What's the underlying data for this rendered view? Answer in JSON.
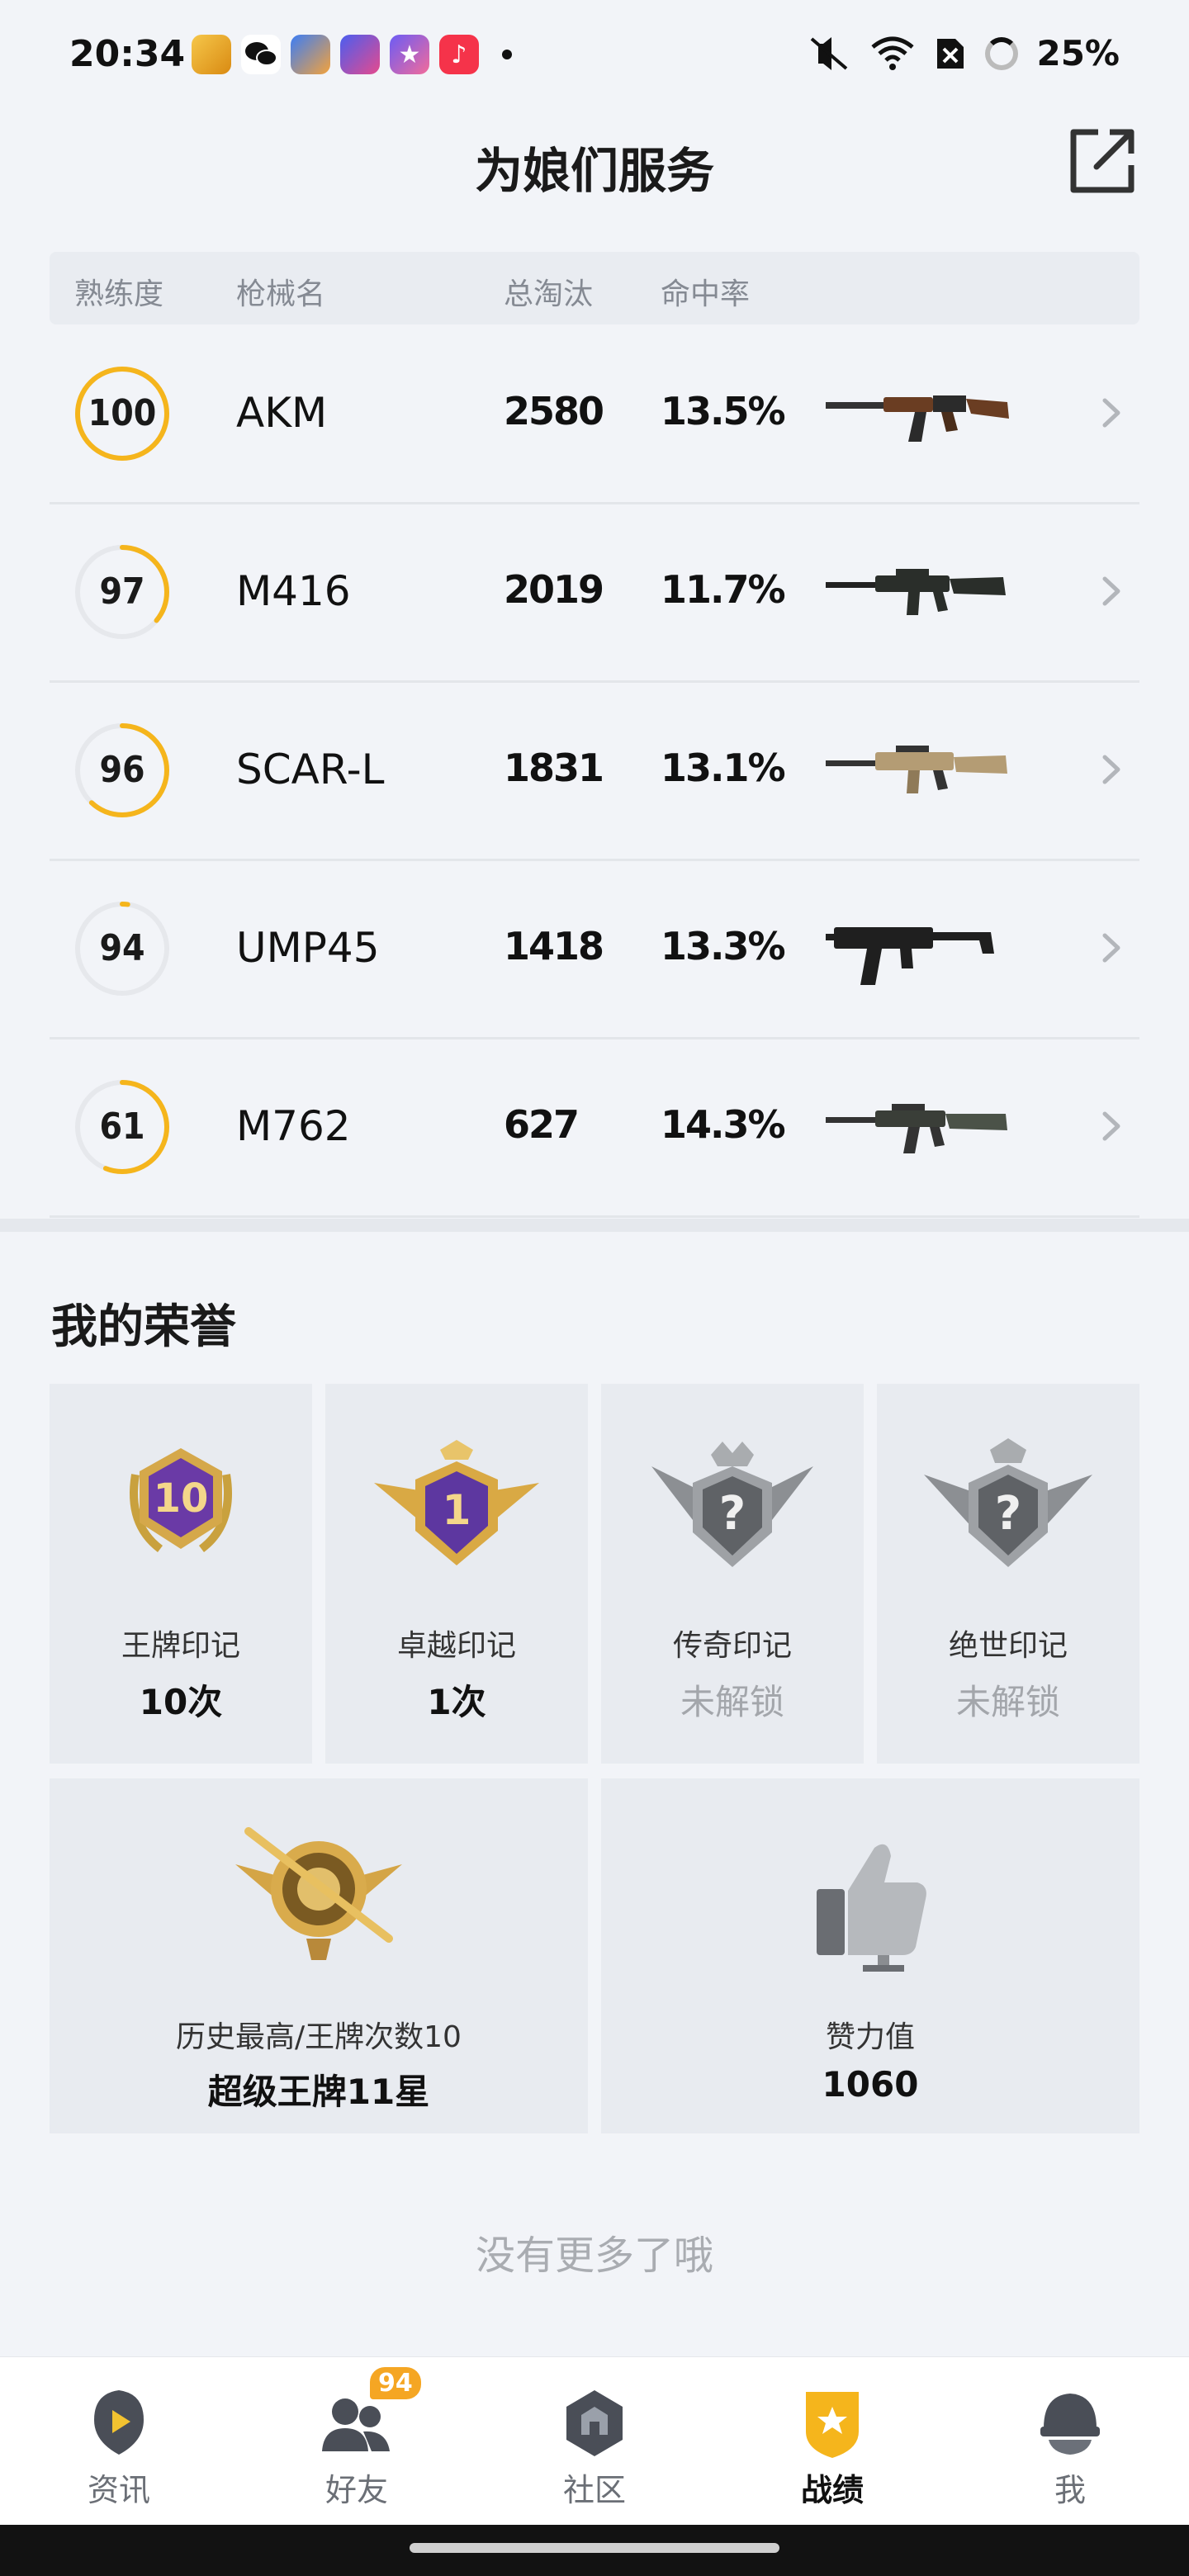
{
  "status_bar": {
    "time": "20:34",
    "battery": "25%",
    "app_icons": [
      "game-app-icon",
      "wechat-icon",
      "game-app-icon-2",
      "game-app-icon-3",
      "star-app-icon",
      "music-app-icon"
    ],
    "indicators": [
      "mute-icon",
      "wifi-icon",
      "sim-off-icon",
      "battery-ring-icon"
    ]
  },
  "header": {
    "title": "为娘们服务",
    "share_icon": "share-icon"
  },
  "weapons": {
    "columns": [
      "熟练度",
      "枪械名",
      "总淘汰",
      "命中率"
    ],
    "rows": [
      {
        "proficiency": "100",
        "progress": 1.0,
        "name": "AKM",
        "kills": "2580",
        "hit_rate": "13.5%"
      },
      {
        "proficiency": "97",
        "progress": 0.36,
        "name": "M416",
        "kills": "2019",
        "hit_rate": "11.7%"
      },
      {
        "proficiency": "96",
        "progress": 0.62,
        "name": "SCAR-L",
        "kills": "1831",
        "hit_rate": "13.1%"
      },
      {
        "proficiency": "94",
        "progress": 0.02,
        "name": "UMP45",
        "kills": "1418",
        "hit_rate": "13.3%"
      },
      {
        "proficiency": "61",
        "progress": 0.56,
        "name": "M762",
        "kills": "627",
        "hit_rate": "14.3%"
      }
    ]
  },
  "honors": {
    "title": "我的荣誉",
    "marks": [
      {
        "label": "王牌印记",
        "value": "10次",
        "badge_text": "10",
        "locked": false
      },
      {
        "label": "卓越印记",
        "value": "1次",
        "badge_text": "1",
        "locked": false
      },
      {
        "label": "传奇印记",
        "value": "未解锁",
        "badge_text": "?",
        "locked": true
      },
      {
        "label": "绝世印记",
        "value": "未解锁",
        "badge_text": "?",
        "locked": true
      }
    ],
    "highest": {
      "label": "历史最高/王牌次数10",
      "value": "超级王牌11星"
    },
    "likes": {
      "label": "赞力值",
      "value": "1060"
    }
  },
  "footer_text": "没有更多了哦",
  "bottom_nav": {
    "items": [
      {
        "label": "资讯",
        "icon": "news-icon",
        "active": false
      },
      {
        "label": "好友",
        "icon": "friends-icon",
        "active": false,
        "badge": "94"
      },
      {
        "label": "社区",
        "icon": "community-icon",
        "active": false
      },
      {
        "label": "战绩",
        "icon": "stats-icon",
        "active": true
      },
      {
        "label": "我",
        "icon": "profile-icon",
        "active": false
      }
    ]
  },
  "colors": {
    "accent": "#f5b51c",
    "ring_track": "#e6e8ec",
    "background": "#f2f4f8",
    "card": "#e8ebf0"
  }
}
